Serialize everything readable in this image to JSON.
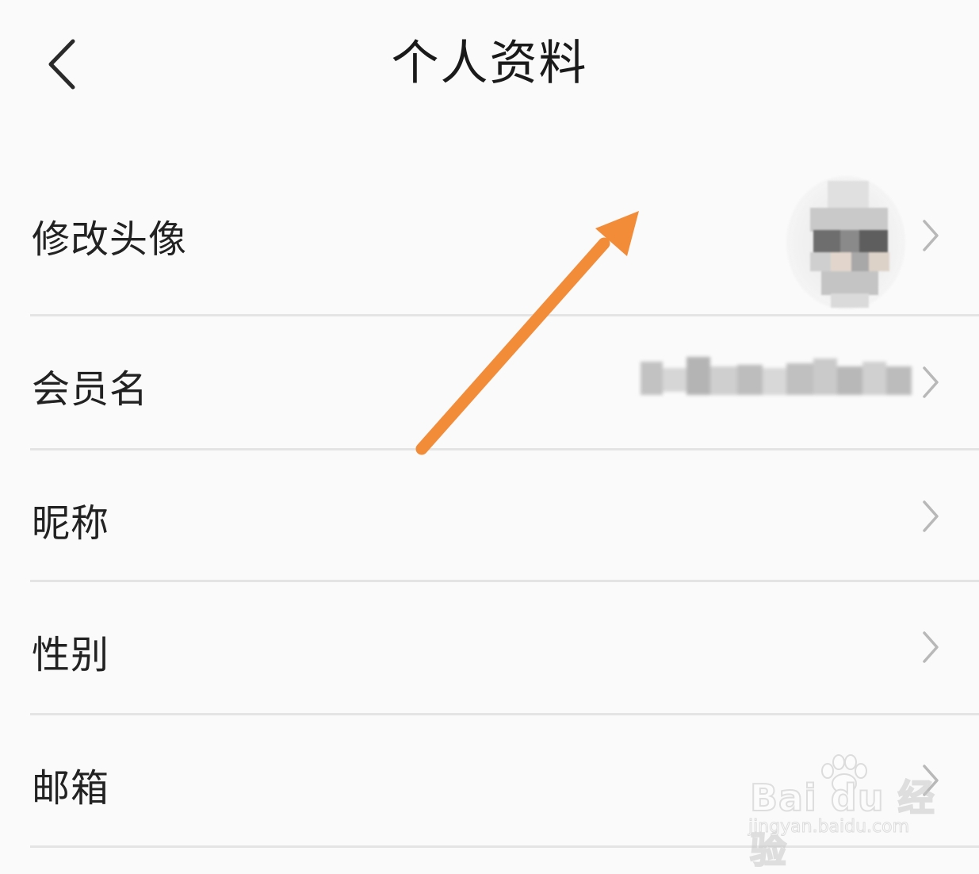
{
  "header": {
    "title": "个人资料",
    "back_icon": "chevron-left-icon"
  },
  "rows": [
    {
      "label": "修改头像",
      "value": "",
      "icon": "chevron-right-icon"
    },
    {
      "label": "会员名",
      "value": "",
      "icon": "chevron-right-icon"
    },
    {
      "label": "昵称",
      "value": "",
      "icon": "chevron-right-icon"
    },
    {
      "label": "性别",
      "value": "",
      "icon": "chevron-right-icon"
    },
    {
      "label": "邮箱",
      "value": "",
      "icon": "chevron-right-icon"
    }
  ],
  "annotation": {
    "color": "#f28c38",
    "icon": "arrow-annotation-icon"
  },
  "watermark": {
    "brand": "Bai du 经验",
    "url": "jingyan.baidu.com"
  },
  "colors": {
    "background": "#fafafa",
    "divider": "#e4e4e4",
    "chevron": "#b8b8b8",
    "text": "#222222"
  }
}
